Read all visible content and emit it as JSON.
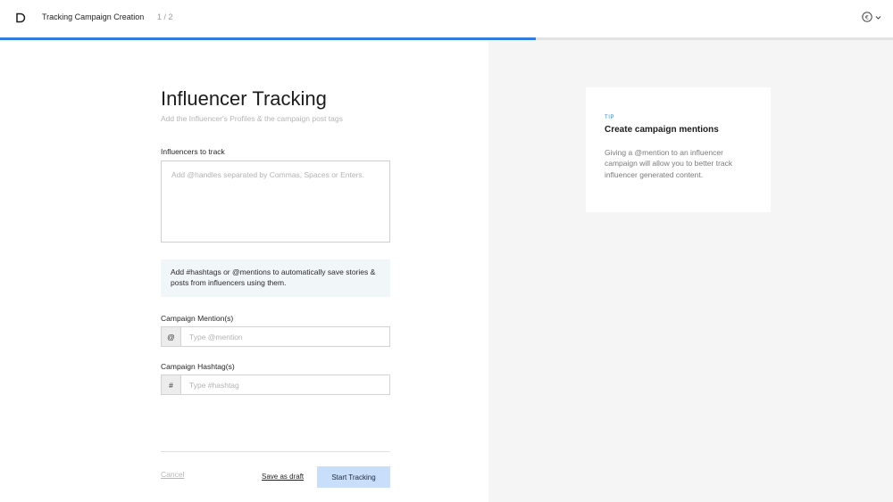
{
  "header": {
    "app_title": "Tracking Campaign Creation",
    "step": "1 / 2",
    "progress_fraction": 0.6,
    "account_currency_symbol": "€",
    "icons": [
      "logo-icon",
      "euro-circle-icon",
      "chevron-down-icon"
    ]
  },
  "form": {
    "title": "Influencer Tracking",
    "subtitle": "Add the Influencer's Profiles & the campaign post tags",
    "influencers_label": "Influencers to track",
    "influencers_placeholder": "Add @handles separated by Commas, Spaces or Enters.",
    "info_text": "Add #hashtags or @mentions to automatically save stories & posts from influencers using them.",
    "mentions_label": "Campaign Mention(s)",
    "mentions_prefix": "@",
    "mentions_placeholder": "Type @mention",
    "hashtags_label": "Campaign Hashtag(s)",
    "hashtags_prefix": "#",
    "hashtags_placeholder": "Type #hashtag"
  },
  "actions": {
    "cancel": "Cancel",
    "save_draft": "Save as draft",
    "start": "Start Tracking"
  },
  "tip": {
    "tag": "TIP",
    "title": "Create campaign mentions",
    "body": "Giving a @mention to an influencer campaign will allow you to better track influencer generated content."
  },
  "colors": {
    "accent": "#2f7de1",
    "start_button": "#c9defa",
    "info_background": "#f1f6f9",
    "side_panel": "#f5f5f5"
  }
}
